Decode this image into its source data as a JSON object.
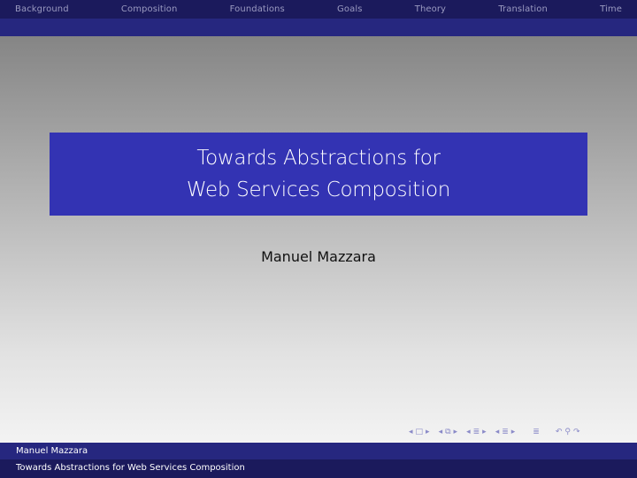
{
  "nav": {
    "sections": [
      "Background",
      "Composition",
      "Foundations",
      "Goals",
      "Theory",
      "Translation",
      "Time"
    ]
  },
  "slide": {
    "title_line1": "Towards Abstractions for",
    "title_line2": "Web Services Composition",
    "author": "Manuel Mazzara"
  },
  "navigation_symbols": {
    "frame_prev": "◂",
    "frame_icon": "□",
    "frame_next": "▸",
    "sub_prev": "◂",
    "sub_icon": "⧉",
    "sub_next": "▸",
    "sec_prev": "◂",
    "sec_icon": "≣",
    "sec_next": "▸",
    "subsec_prev": "◂",
    "subsec_icon": "≣",
    "subsec_next": "▸",
    "doc_icon": "≣",
    "back_icon": "↶",
    "search_icon": "⚲",
    "forward_icon": "↷"
  },
  "footer": {
    "author": "Manuel Mazzara",
    "title": "Towards Abstractions for Web Services Composition"
  },
  "colors": {
    "nav_dark": "#1b1a5c",
    "nav_mid": "#26277f",
    "title_box": "#3333b3"
  }
}
